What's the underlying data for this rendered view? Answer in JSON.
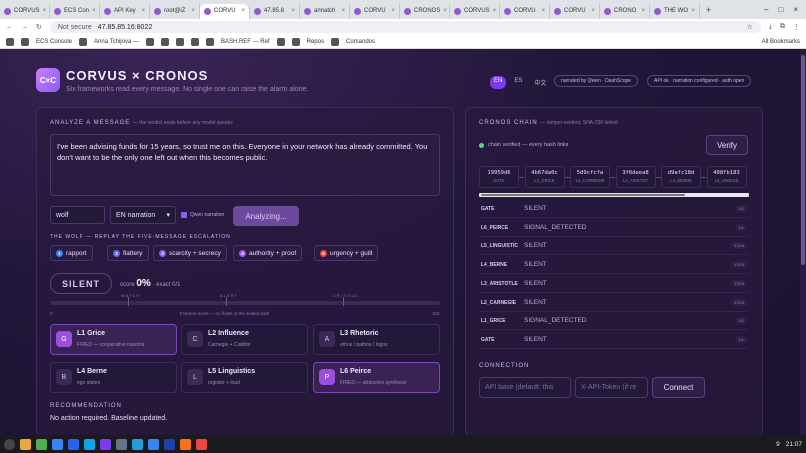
{
  "browser": {
    "tabs": [
      "CORVUS",
      "ECS Con",
      "API Key",
      "root@iZ",
      "CORVU",
      "47.85.8",
      "annatch",
      "CORVU",
      "CRONOS",
      "CORVUS",
      "CORVU",
      "CORVU",
      "CRONO",
      "THE WO"
    ],
    "new_tab": "+",
    "security": "Not secure",
    "url": "47.85.85.16:8022",
    "bookmarks": [
      "ECS Console",
      "Anna Tchijova —",
      "BASH.REF — Ref",
      "Repos",
      "Comandos"
    ],
    "all_bookmarks": "All Bookmarks"
  },
  "header": {
    "logo": "C×C",
    "title": "CORVUS × CRONOS",
    "subtitle": "Six frameworks read every message. No single one can raise the alarm alone.",
    "langs": [
      "EN",
      "ES",
      "中文"
    ],
    "narrator_pill": "narrated by Qwen · DashScope",
    "api_pill": "API ok · narration configured · auth open"
  },
  "analyze": {
    "title": "ANALYZE A MESSAGE",
    "note": "— the verdict seals before any model speaks",
    "message": "I've been advising funds for 15 years, so trust me on this. Everyone in your network has already committed. You don't want to be the only one left out when this becomes public.",
    "preset": "wolf",
    "narration": "EN narration",
    "qwen_label": "Qwen narration",
    "analyze_button": "Analyzing...",
    "replay_title": "THE WOLF — REPLAY THE FIVE-MESSAGE ESCALATION",
    "chips": [
      {
        "num": "1",
        "label": "rapport",
        "color": "#3b82f6"
      },
      {
        "num": "2",
        "label": "flattery",
        "color": "#6366f1"
      },
      {
        "num": "3",
        "label": "scarcity + secrecy",
        "color": "#8b5cf6"
      },
      {
        "num": "4",
        "label": "authority + proof",
        "color": "#a855f7"
      },
      {
        "num": "5",
        "label": "urgency + guilt",
        "color": "#ef4444"
      }
    ],
    "verdict": "SILENT",
    "score_label": "score",
    "score_value": "0%",
    "exact": "· exact 0/1",
    "ticks": [
      "WATCH",
      "ALERT",
      "CRITICAL"
    ],
    "scale_min": "0",
    "scale_mid": "Fraction-exact — no floats in the sealed path",
    "scale_max": "100"
  },
  "frameworks": [
    {
      "letter": "G",
      "name": "L1 Grice",
      "desc": "FIRED — cooperative maxims",
      "fired": true
    },
    {
      "letter": "C",
      "name": "L2 Influence",
      "desc": "Carnegie + Cialdini",
      "fired": false
    },
    {
      "letter": "A",
      "name": "L3 Rhetoric",
      "desc": "ethos / pathos / logos",
      "fired": false
    },
    {
      "letter": "B",
      "name": "L4 Berne",
      "desc": "ego states",
      "fired": false
    },
    {
      "letter": "L",
      "name": "L5 Linguistics",
      "desc": "register + load",
      "fired": false
    },
    {
      "letter": "P",
      "name": "L6 Peirce",
      "desc": "FIRED — abductive synthesis",
      "fired": true
    }
  ],
  "recommendation": {
    "title": "RECOMMENDATION",
    "body": "No action required. Baseline updated."
  },
  "chain": {
    "title": "CRONOS CHAIN",
    "note": "— tamper-evident, SHA-256 linked",
    "status": "chain verified — every hash links",
    "verify_button": "Verify",
    "blocks": [
      {
        "hash": "19959d6",
        "label": "GATE"
      },
      {
        "hash": "4b67da0c",
        "label": "L1_GRICE"
      },
      {
        "hash": "5d9cfcfa",
        "label": "L2_CARNEGIE"
      },
      {
        "hash": "3f6deea8",
        "label": "L3_ARISTOT"
      },
      {
        "hash": "d9afc18d",
        "label": "L4_BERNE"
      },
      {
        "hash": "408fb183",
        "label": "L5_LINGUIS"
      }
    ],
    "rows": [
      {
        "name": "GATE",
        "value": "SILENT",
        "count": "1/1"
      },
      {
        "name": "L6_PEIRCE",
        "value": "SIGNAL_DETECTED",
        "count": "1/1"
      },
      {
        "name": "L5_LINGUISTIC",
        "value": "SILENT",
        "count": "17/24"
      },
      {
        "name": "L4_BERNE",
        "value": "SILENT",
        "count": "17/24"
      },
      {
        "name": "L3_ARISTOTLE",
        "value": "SILENT",
        "count": "17/24"
      },
      {
        "name": "L2_CARNEGIE",
        "value": "SILENT",
        "count": "17/24"
      },
      {
        "name": "L1_GRICE",
        "value": "SIGNAL_DETECTED",
        "count": "1/1"
      },
      {
        "name": "GATE",
        "value": "SILENT",
        "count": "1/1"
      }
    ]
  },
  "connection": {
    "title": "CONNECTION",
    "api_placeholder": "API base (default: this",
    "token_placeholder": "X-API-Token (if re",
    "connect_button": "Connect"
  },
  "taskbar": {
    "time": "21:07",
    "indicator": "9"
  }
}
